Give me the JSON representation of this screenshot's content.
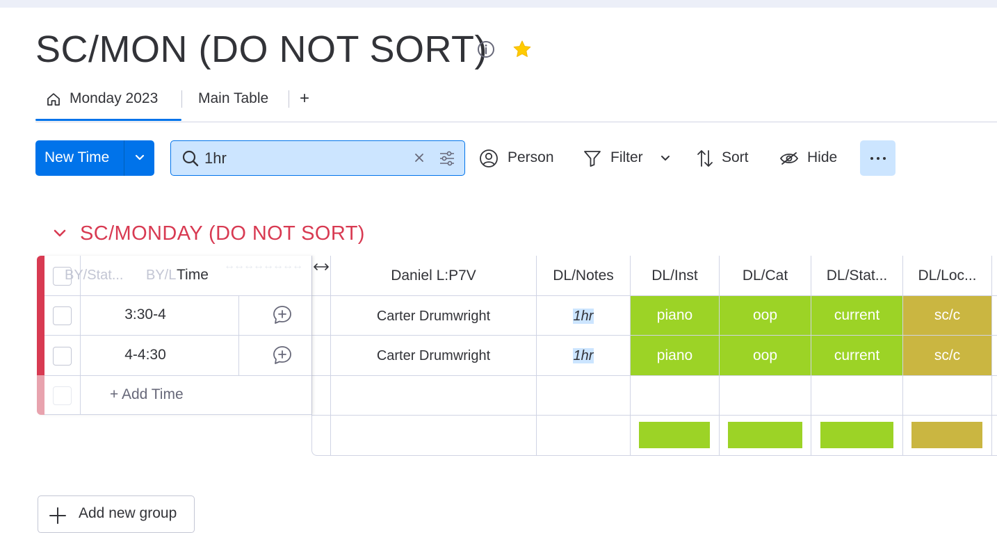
{
  "board": {
    "title": "SC/MON (DO NOT SORT)"
  },
  "tabs": [
    {
      "label": "Monday 2023",
      "active": true
    },
    {
      "label": "Main Table"
    },
    {
      "label": "+"
    }
  ],
  "toolbar": {
    "new_item_label": "New Time",
    "search_value": "1hr",
    "person_label": "Person",
    "filter_label": "Filter",
    "sort_label": "Sort",
    "hide_label": "Hide"
  },
  "group": {
    "title": "SC/MONDAY (DO NOT SORT)",
    "color": "#d83a52",
    "left_headers": {
      "ghost1": "BY/Stat...",
      "ghost2": "BY/L",
      "time": "Time"
    },
    "columns": [
      "Daniel L:P7V",
      "DL/Notes",
      "DL/Inst",
      "DL/Cat",
      "DL/Stat...",
      "DL/Loc..."
    ],
    "rows": [
      {
        "time": "3:30-4",
        "person": "Carter Drumwright",
        "notes": "1hr",
        "inst": "piano",
        "cat": "oop",
        "status": "current",
        "loc": "sc/c"
      },
      {
        "time": "4-4:30",
        "person": "Carter Drumwright",
        "notes": "1hr",
        "inst": "piano",
        "cat": "oop",
        "status": "current",
        "loc": "sc/c"
      }
    ],
    "add_item_label": "+ Add Time",
    "status_colors": {
      "green": "#9cd326",
      "olive": "#cab641"
    }
  },
  "add_group_label": "Add new group"
}
